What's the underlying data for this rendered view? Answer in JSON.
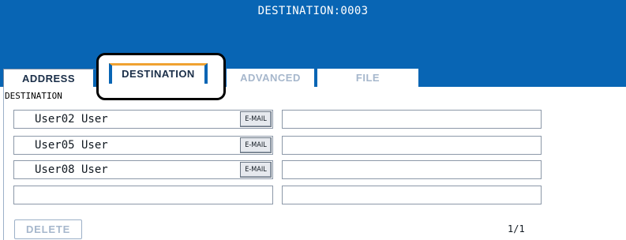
{
  "header": {
    "title": "DESTINATION:0003"
  },
  "tabs": {
    "address": "ADDRESS",
    "destination": "DESTINATION",
    "advanced": "ADVANCED",
    "file": "FILE"
  },
  "section": {
    "label": "DESTINATION"
  },
  "rows": [
    {
      "name": "User02 User",
      "type_label": "E-MAIL",
      "address": ""
    },
    {
      "name": "User05 User",
      "type_label": "E-MAIL",
      "address": ""
    },
    {
      "name": "User08 User",
      "type_label": "E-MAIL",
      "address": ""
    },
    {
      "name": "",
      "type_label": "",
      "address": ""
    }
  ],
  "footer": {
    "delete_label": "DELETE",
    "page": "1/1"
  },
  "colors": {
    "header_bg": "#0865b4",
    "tab_accent": "#f0a232",
    "disabled_text": "#a6b7cc"
  }
}
